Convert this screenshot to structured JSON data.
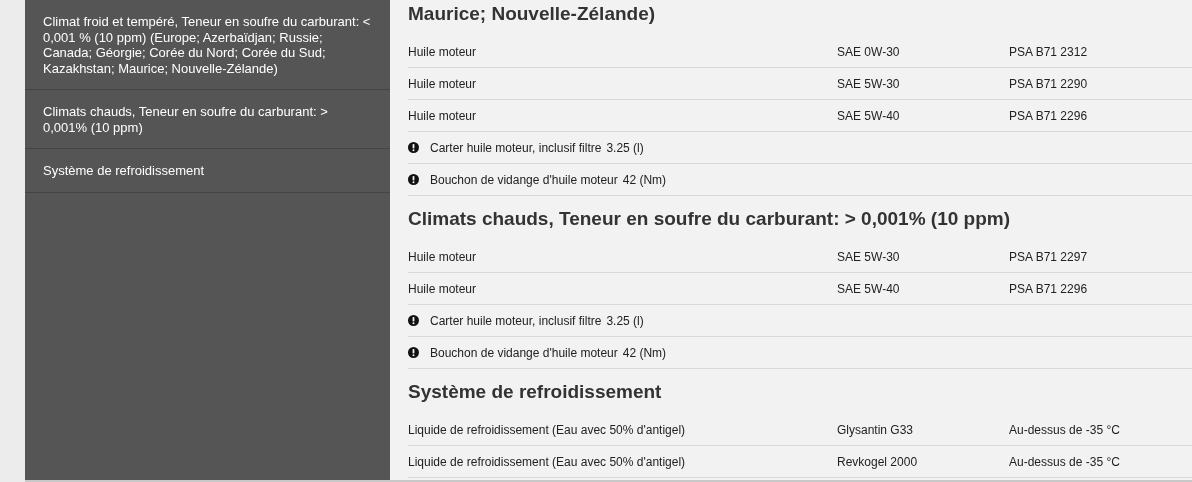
{
  "sidebar": {
    "items": [
      {
        "label": "Climat froid et tempéré, Teneur en soufre du carburant: < 0,001 % (10 ppm) (Europe; Azerbaïdjan; Russie; Canada; Géorgie; Corée du Nord; Corée du Sud; Kazakhstan; Maurice; Nouvelle-Zélande)",
        "selected": false
      },
      {
        "label": "Climats chauds, Teneur en soufre du carburant: > 0,001% (10 ppm)",
        "selected": false
      },
      {
        "label": "Système de refroidissement",
        "selected": false
      }
    ]
  },
  "sections": [
    {
      "title": "Maurice; Nouvelle-Zélande)",
      "rows": [
        {
          "kind": "spec",
          "cells": [
            "Huile moteur",
            "SAE 0W-30",
            "PSA B71 2312"
          ]
        },
        {
          "kind": "spec",
          "cells": [
            "Huile moteur",
            "SAE 5W-30",
            "PSA B71 2290"
          ]
        },
        {
          "kind": "spec",
          "cells": [
            "Huile moteur",
            "SAE 5W-40",
            "PSA B71 2296"
          ]
        },
        {
          "kind": "note",
          "label": "Carter huile moteur, inclusif filtre",
          "value": "3.25 (l)"
        },
        {
          "kind": "note",
          "label": "Bouchon de vidange d'huile moteur",
          "value": "42 (Nm)"
        }
      ]
    },
    {
      "title": "Climats chauds, Teneur en soufre du carburant: > 0,001% (10 ppm)",
      "rows": [
        {
          "kind": "spec",
          "cells": [
            "Huile moteur",
            "SAE 5W-30",
            "PSA B71 2297"
          ]
        },
        {
          "kind": "spec",
          "cells": [
            "Huile moteur",
            "SAE 5W-40",
            "PSA B71 2296"
          ]
        },
        {
          "kind": "note",
          "label": "Carter huile moteur, inclusif filtre",
          "value": "3.25 (l)"
        },
        {
          "kind": "note",
          "label": "Bouchon de vidange d'huile moteur",
          "value": "42 (Nm)"
        }
      ]
    },
    {
      "title": "Système de refroidissement",
      "rows": [
        {
          "kind": "spec",
          "cells": [
            "Liquide de refroidissement (Eau avec 50% d'antigel)",
            "Glysantin G33",
            "Au-dessus de -35 °C"
          ]
        },
        {
          "kind": "spec",
          "cells": [
            "Liquide de refroidissement (Eau avec 50% d'antigel)",
            "Revkogel 2000",
            "Au-dessus de -35 °C"
          ]
        }
      ]
    }
  ]
}
